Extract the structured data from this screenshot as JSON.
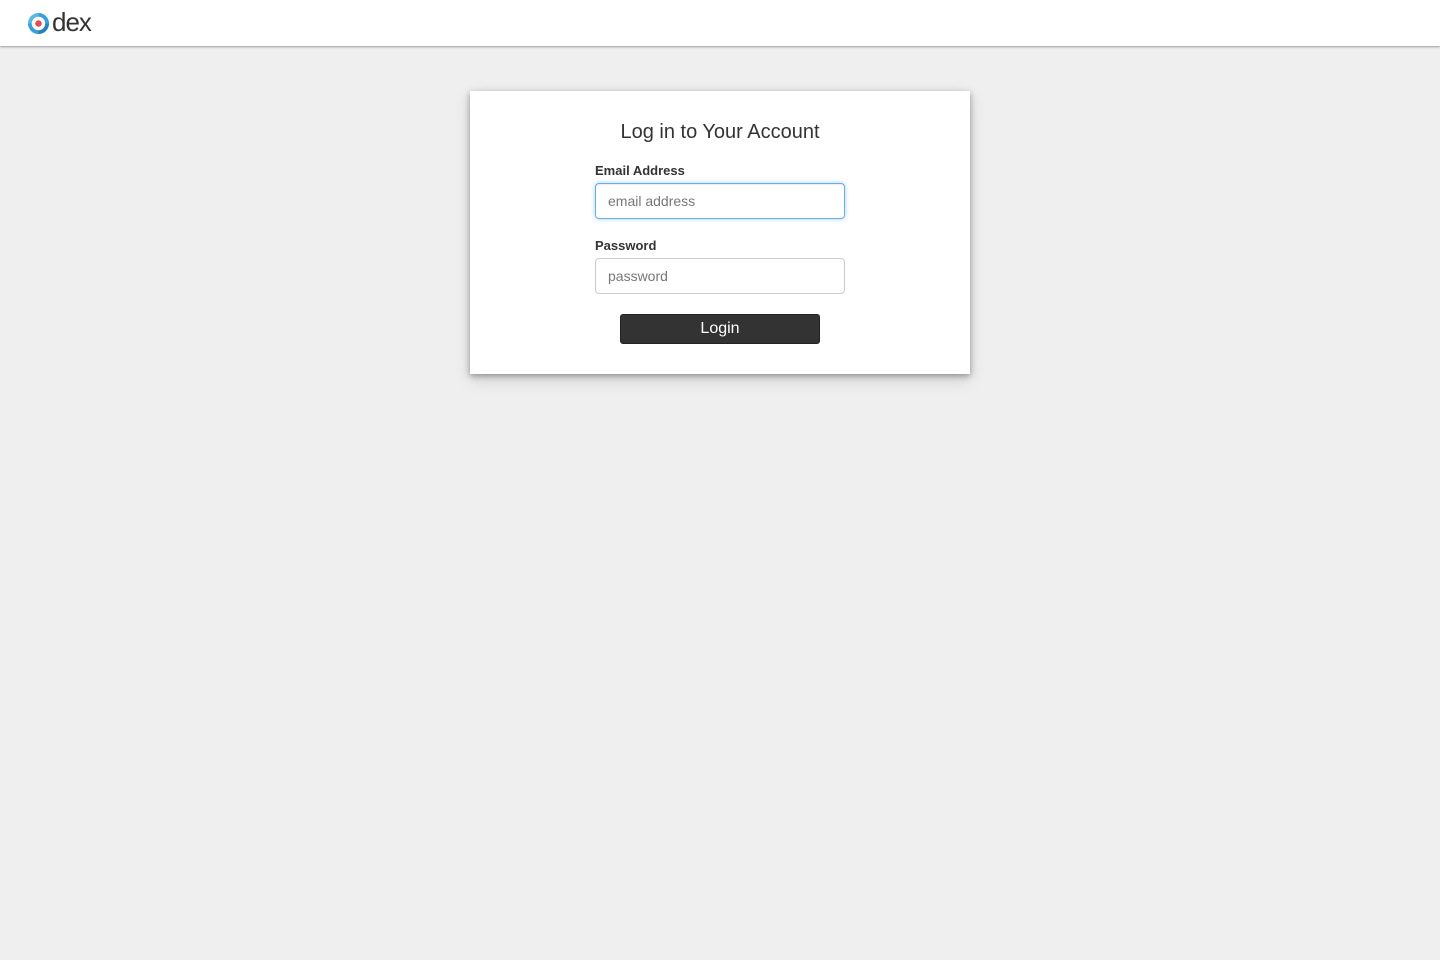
{
  "header": {
    "logo_text": "dex",
    "logo_icon": "dex-logo-icon"
  },
  "login": {
    "title": "Log in to Your Account",
    "email_label": "Email Address",
    "email_value": "",
    "email_placeholder": "email address",
    "password_label": "Password",
    "password_value": "",
    "password_placeholder": "password",
    "submit_label": "Login"
  },
  "colors": {
    "background": "#efefef",
    "header_bg": "#ffffff",
    "card_bg": "#ffffff",
    "button_bg": "#333333",
    "button_text": "#ffffff",
    "focus_border": "#66afe9",
    "logo_blue": "#3aa0d8",
    "logo_red": "#e94a5a"
  }
}
